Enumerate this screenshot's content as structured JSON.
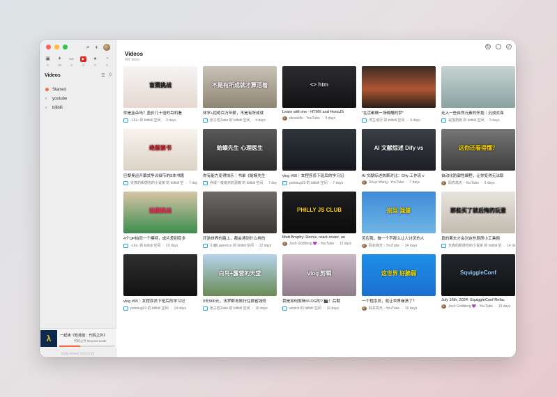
{
  "sidebar": {
    "sources": [
      {
        "icon": "bilibili-icon",
        "count": "0"
      },
      {
        "icon": "twitter-icon",
        "count": "29"
      },
      {
        "icon": "image-icon",
        "count": "0"
      },
      {
        "icon": "youtube-icon",
        "count": "6"
      },
      {
        "icon": "podcast-icon",
        "count": "0"
      },
      {
        "icon": "rss-icon",
        "count": "0"
      }
    ],
    "section_title": "Videos",
    "section_count": "0",
    "nav": [
      {
        "label": "Starred",
        "type": "starred"
      },
      {
        "label": "youtube",
        "type": "folder"
      },
      {
        "label": "bilibili",
        "type": "folder"
      }
    ],
    "player": {
      "title": "一起读《软技能：代码之外》",
      "subtitle": "代码之外 Beyond Code",
      "progress": 0.38
    },
    "footer": "Early Access 2024.8.29"
  },
  "main": {
    "title": "Videos",
    "count": "490 items",
    "videos": [
      {
        "title": "你是金朵吗？盖价几十倍的耳机看",
        "channel": "-LKs- 的 bilibili 空间",
        "age": "3 days",
        "thumb_text": "盲猜挑战",
        "bg": "linear-gradient(180deg,#f5f5f5 0%,#e6d7cf 100%)",
        "color": "#1a1a1a",
        "meta": "bili"
      },
      {
        "title": "休学+拒绝百万年薪，不是有所成就",
        "channel": "张子哲Zake 的 bilibili 空间",
        "age": "4 days",
        "thumb_text": "不是有所成就才算活着",
        "bg": "linear-gradient(180deg,#c9c2b6 0%,#8f8574 100%)",
        "color": "#fff",
        "meta": "bili"
      },
      {
        "title": "Learn with me - HTMX and HonoJS",
        "channel": "devaslife - YouTube",
        "age": "4 days",
        "thumb_text": "<> htm",
        "bg": "linear-gradient(180deg,#2c2c30 0%,#121214 100%)",
        "color": "#ddd",
        "meta": "person"
      },
      {
        "title": "\"在京都做一场微醺的梦\"",
        "channel": "浮生诗行 的 bilibili 空间",
        "age": "4 days",
        "thumb_text": "",
        "bg": "linear-gradient(180deg,#3a2b22 0%,#b05634 55%,#2a1e19 100%)",
        "color": "#fff",
        "meta": "bili"
      },
      {
        "title": "走入一些自然元素的怀抱｜沉浸式海",
        "channel": "是落拓郎 的 bilibili 空间",
        "age": "5 days",
        "thumb_text": "",
        "bg": "linear-gradient(180deg,#c7d4d3 0%,#8aa2a0 100%)",
        "color": "#fff",
        "meta": "bili"
      },
      {
        "title": "巴黎奥运开幕式争议细节的9本书籍",
        "channel": "天真的和感伤的小说家 的 bilibili 空",
        "age": "7 days",
        "thumb_text": "绝版禁书",
        "bg": "linear-gradient(180deg,#f7f3ee 0%,#ddd3c6 100%)",
        "color": "#c3131b",
        "meta": "bili"
      },
      {
        "title": "你有能力变得快乐｜书单《蛤蟆先生",
        "channel": "养成一枝雨天的蔷薇 的 bilibili 空间",
        "age": "7 days",
        "thumb_text": "蛤蟆先生 心理医生",
        "bg": "linear-gradient(180deg,#5a5a5a 0%,#2b2b2b 100%)",
        "color": "#fff",
        "meta": "bili"
      },
      {
        "title": "vlog #66｜女程序员下班后的学习记",
        "channel": "polebug23 的 bilibili 空间",
        "age": "7 days",
        "thumb_text": "",
        "bg": "linear-gradient(180deg,#30363c 0%,#14181c 100%)",
        "color": "#fff",
        "meta": "bili"
      },
      {
        "title": "AI 文献综述效果对比：Dify 工作流 v",
        "channel": "Shuyi Wang - YouTube",
        "age": "7 days",
        "thumb_text": "AI 文献综述 Dify vs",
        "bg": "linear-gradient(180deg,#3b3f46 0%,#1b1e23 100%)",
        "color": "#fff",
        "meta": "person"
      },
      {
        "title": "自动化防御性编程，让你变得无法取",
        "channel": "码农高天 - YouTube",
        "age": "9 days",
        "thumb_text": "这你还看得懂？",
        "bg": "linear-gradient(180deg,#767676 0%,#3e3e3e 100%)",
        "color": "#f5d400",
        "meta": "person"
      },
      {
        "title": "4个UP拍同一个模特，成片差别有多",
        "channel": "-LKs- 的 bilibili 空间",
        "age": "10 days",
        "thumb_text": "拍摄挑战",
        "bg": "linear-gradient(180deg,#d8c4a6 0%,#3c8e4e 100%)",
        "color": "#ff2a5a",
        "meta": "bili"
      },
      {
        "title": "环游世界的路上，都会遇到什么样的",
        "channel": "小鹿Lawrence 的 bilibili 空间",
        "age": "12 days",
        "thumb_text": "",
        "bg": "linear-gradient(180deg,#6d6a68 0%,#3a3735 100%)",
        "color": "#fff",
        "meta": "bili"
      },
      {
        "title": "Matt Brophy: Remix, react-router, an",
        "channel": "Josh Goldberg 💜 - YouTube",
        "age": "12 days",
        "thumb_text": "PHILLY JS CLUB",
        "bg": "linear-gradient(180deg,#1f1f22 0%,#0c0c0d 100%)",
        "color": "#ffd400",
        "meta": "person"
      },
      {
        "title": "苦应我，做一个不那么让人讨厌的人",
        "channel": "码农高天 - YouTube",
        "age": "14 days",
        "thumb_text": "别当 混蛋",
        "bg": "linear-gradient(180deg,#3f8bd8 0%,#6fb5e6 100%)",
        "color": "#ffe000",
        "meta": "person"
      },
      {
        "title": "真的寒夫才会对这些厨房小工具抱",
        "channel": "天真的和感伤的小说家 的 bilibili 空",
        "age": "14 days",
        "thumb_text": "那些买了就后悔的玩意",
        "bg": "linear-gradient(180deg,#e8e4de 0%,#c2baae 100%)",
        "color": "#1a1a1a",
        "meta": "bili"
      },
      {
        "title": "vlog #65｜女程序员下班后的学习记",
        "channel": "polebug23 的 bilibili 空间",
        "age": "14 days",
        "thumb_text": "",
        "bg": "linear-gradient(180deg,#2f2f2f 0%,#111 100%)",
        "color": "#fff",
        "meta": "bili"
      },
      {
        "title": "9天900元，法罗群岛旅行住宿省钱窍",
        "channel": "张子哲Zake 的 bilibili 空间",
        "age": "16 days",
        "thumb_text": "白鸟+露营的天堂",
        "bg": "linear-gradient(180deg,#b6d4ee 0%,#6a8a55 100%)",
        "color": "#fff",
        "meta": "bili"
      },
      {
        "title": "我是如何剪辑VLOG的? 🎬！后期",
        "channel": "amiich 的 bilibili 空间",
        "age": "16 days",
        "thumb_text": "vlog 剪辑",
        "bg": "linear-gradient(180deg,#c9b7c4 0%,#8e7c8a 100%)",
        "color": "#fff",
        "meta": "bili"
      },
      {
        "title": "一个程序员，就让世界崩溃了？",
        "channel": "码农高天 - YouTube",
        "age": "16 days",
        "thumb_text": "这世界 好脆弱",
        "bg": "linear-gradient(180deg,#1e8fe6 0%,#1c6fd2 100%)",
        "color": "#ffe000",
        "meta": "person"
      },
      {
        "title": "July 16th, 2024: SquiggleConf Refac",
        "channel": "Josh Goldberg 💜 - YouTube",
        "age": "16 days",
        "thumb_text": "SquiggleConf",
        "bg": "linear-gradient(180deg,#23262b 0%,#0f1113 100%)",
        "color": "#9cd0ff",
        "meta": "person"
      }
    ]
  },
  "icons": {
    "search": "search-icon",
    "add": "plus-icon",
    "avatar": "avatar",
    "refresh": "refresh-icon",
    "circle": "circle-icon",
    "check": "check-circle-icon"
  }
}
